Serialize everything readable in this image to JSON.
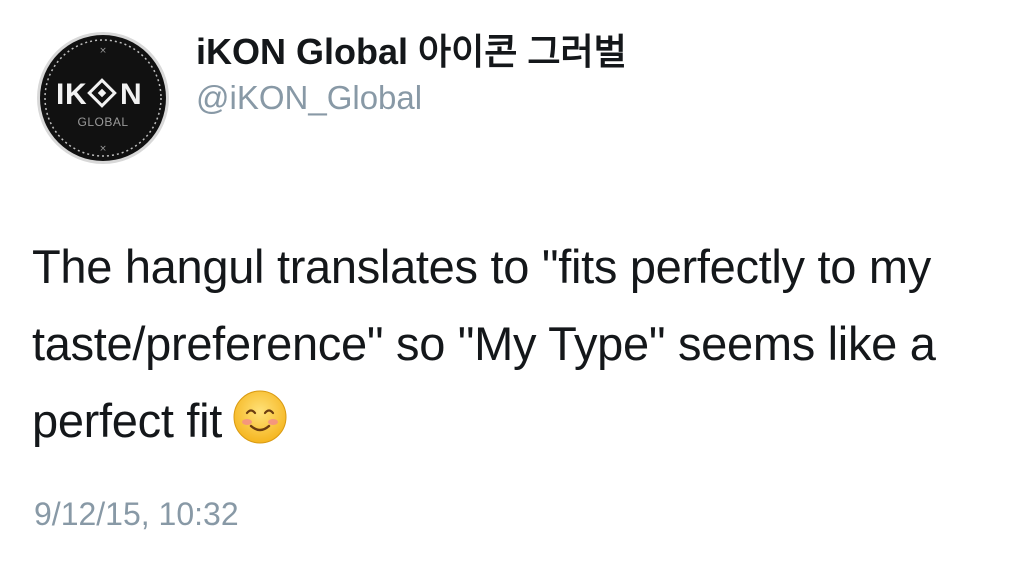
{
  "tweet": {
    "display_name": "iKON Global 아이콘 그러벌",
    "handle": "@iKON_Global",
    "text": "The hangul translates to \"fits perfectly to my taste/preference\" so \"My Type\" seems like a perfect fit",
    "emoji": "smiling-face-emoji",
    "timestamp": "9/12/15, 10:32"
  },
  "avatar": {
    "logo_text": "IKON",
    "sub_text": "GLOBAL",
    "icon": "ikon-logo-icon"
  },
  "colors": {
    "text": "#14171a",
    "secondary": "#8899a6",
    "avatar_bg": "#111111"
  }
}
